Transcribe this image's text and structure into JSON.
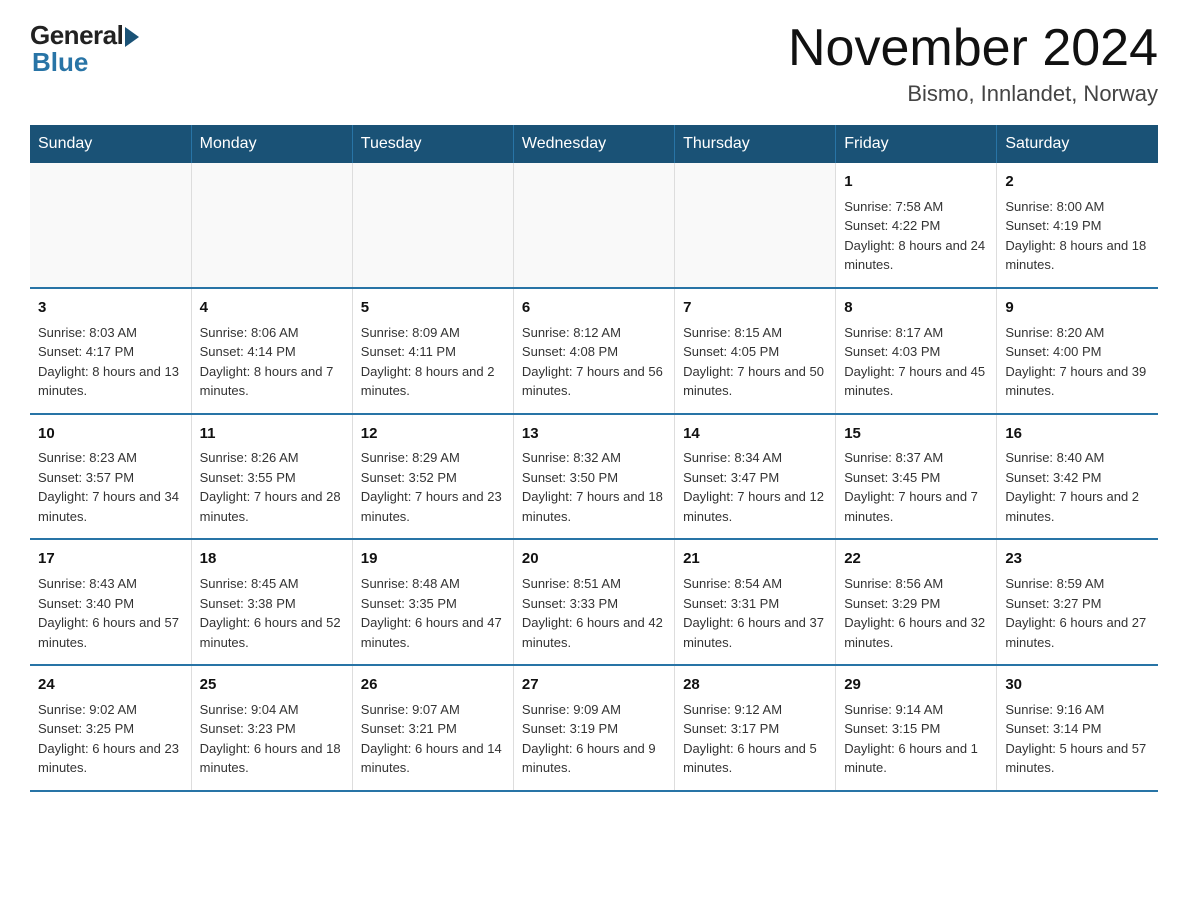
{
  "header": {
    "logo_general": "General",
    "logo_blue": "Blue",
    "month_title": "November 2024",
    "location": "Bismo, Innlandet, Norway"
  },
  "days_of_week": [
    "Sunday",
    "Monday",
    "Tuesday",
    "Wednesday",
    "Thursday",
    "Friday",
    "Saturday"
  ],
  "weeks": [
    [
      {
        "day": "",
        "info": ""
      },
      {
        "day": "",
        "info": ""
      },
      {
        "day": "",
        "info": ""
      },
      {
        "day": "",
        "info": ""
      },
      {
        "day": "",
        "info": ""
      },
      {
        "day": "1",
        "info": "Sunrise: 7:58 AM\nSunset: 4:22 PM\nDaylight: 8 hours and 24 minutes."
      },
      {
        "day": "2",
        "info": "Sunrise: 8:00 AM\nSunset: 4:19 PM\nDaylight: 8 hours and 18 minutes."
      }
    ],
    [
      {
        "day": "3",
        "info": "Sunrise: 8:03 AM\nSunset: 4:17 PM\nDaylight: 8 hours and 13 minutes."
      },
      {
        "day": "4",
        "info": "Sunrise: 8:06 AM\nSunset: 4:14 PM\nDaylight: 8 hours and 7 minutes."
      },
      {
        "day": "5",
        "info": "Sunrise: 8:09 AM\nSunset: 4:11 PM\nDaylight: 8 hours and 2 minutes."
      },
      {
        "day": "6",
        "info": "Sunrise: 8:12 AM\nSunset: 4:08 PM\nDaylight: 7 hours and 56 minutes."
      },
      {
        "day": "7",
        "info": "Sunrise: 8:15 AM\nSunset: 4:05 PM\nDaylight: 7 hours and 50 minutes."
      },
      {
        "day": "8",
        "info": "Sunrise: 8:17 AM\nSunset: 4:03 PM\nDaylight: 7 hours and 45 minutes."
      },
      {
        "day": "9",
        "info": "Sunrise: 8:20 AM\nSunset: 4:00 PM\nDaylight: 7 hours and 39 minutes."
      }
    ],
    [
      {
        "day": "10",
        "info": "Sunrise: 8:23 AM\nSunset: 3:57 PM\nDaylight: 7 hours and 34 minutes."
      },
      {
        "day": "11",
        "info": "Sunrise: 8:26 AM\nSunset: 3:55 PM\nDaylight: 7 hours and 28 minutes."
      },
      {
        "day": "12",
        "info": "Sunrise: 8:29 AM\nSunset: 3:52 PM\nDaylight: 7 hours and 23 minutes."
      },
      {
        "day": "13",
        "info": "Sunrise: 8:32 AM\nSunset: 3:50 PM\nDaylight: 7 hours and 18 minutes."
      },
      {
        "day": "14",
        "info": "Sunrise: 8:34 AM\nSunset: 3:47 PM\nDaylight: 7 hours and 12 minutes."
      },
      {
        "day": "15",
        "info": "Sunrise: 8:37 AM\nSunset: 3:45 PM\nDaylight: 7 hours and 7 minutes."
      },
      {
        "day": "16",
        "info": "Sunrise: 8:40 AM\nSunset: 3:42 PM\nDaylight: 7 hours and 2 minutes."
      }
    ],
    [
      {
        "day": "17",
        "info": "Sunrise: 8:43 AM\nSunset: 3:40 PM\nDaylight: 6 hours and 57 minutes."
      },
      {
        "day": "18",
        "info": "Sunrise: 8:45 AM\nSunset: 3:38 PM\nDaylight: 6 hours and 52 minutes."
      },
      {
        "day": "19",
        "info": "Sunrise: 8:48 AM\nSunset: 3:35 PM\nDaylight: 6 hours and 47 minutes."
      },
      {
        "day": "20",
        "info": "Sunrise: 8:51 AM\nSunset: 3:33 PM\nDaylight: 6 hours and 42 minutes."
      },
      {
        "day": "21",
        "info": "Sunrise: 8:54 AM\nSunset: 3:31 PM\nDaylight: 6 hours and 37 minutes."
      },
      {
        "day": "22",
        "info": "Sunrise: 8:56 AM\nSunset: 3:29 PM\nDaylight: 6 hours and 32 minutes."
      },
      {
        "day": "23",
        "info": "Sunrise: 8:59 AM\nSunset: 3:27 PM\nDaylight: 6 hours and 27 minutes."
      }
    ],
    [
      {
        "day": "24",
        "info": "Sunrise: 9:02 AM\nSunset: 3:25 PM\nDaylight: 6 hours and 23 minutes."
      },
      {
        "day": "25",
        "info": "Sunrise: 9:04 AM\nSunset: 3:23 PM\nDaylight: 6 hours and 18 minutes."
      },
      {
        "day": "26",
        "info": "Sunrise: 9:07 AM\nSunset: 3:21 PM\nDaylight: 6 hours and 14 minutes."
      },
      {
        "day": "27",
        "info": "Sunrise: 9:09 AM\nSunset: 3:19 PM\nDaylight: 6 hours and 9 minutes."
      },
      {
        "day": "28",
        "info": "Sunrise: 9:12 AM\nSunset: 3:17 PM\nDaylight: 6 hours and 5 minutes."
      },
      {
        "day": "29",
        "info": "Sunrise: 9:14 AM\nSunset: 3:15 PM\nDaylight: 6 hours and 1 minute."
      },
      {
        "day": "30",
        "info": "Sunrise: 9:16 AM\nSunset: 3:14 PM\nDaylight: 5 hours and 57 minutes."
      }
    ]
  ]
}
